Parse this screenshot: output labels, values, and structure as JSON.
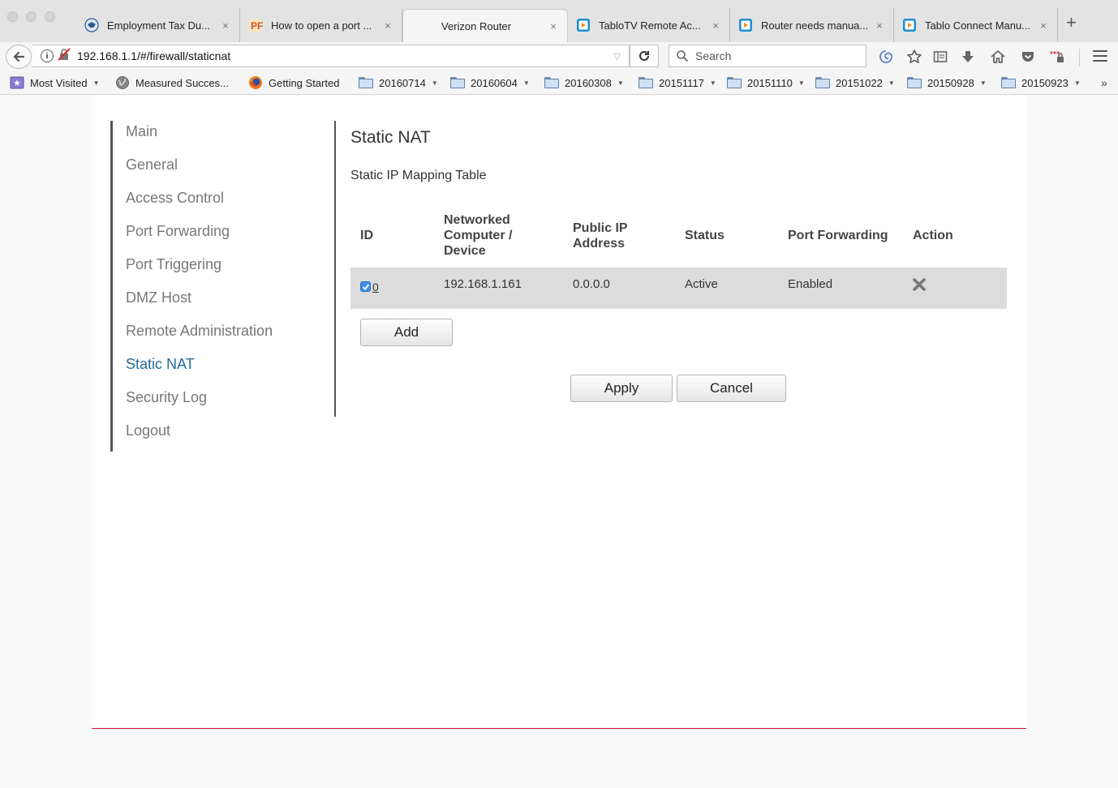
{
  "browser": {
    "tabs": [
      {
        "title": "Employment Tax Du...",
        "favicon": "irs-eagle-icon"
      },
      {
        "title": "How to open a port ...",
        "favicon": "portforward-icon"
      },
      {
        "title": "Verizon Router",
        "favicon": "none",
        "active": true
      },
      {
        "title": "TabloTV Remote Ac...",
        "favicon": "tablo-icon"
      },
      {
        "title": "Router needs manua...",
        "favicon": "tablo-icon"
      },
      {
        "title": "Tablo Connect Manu...",
        "favicon": "tablo-icon"
      }
    ],
    "new_tab_label": "+",
    "close_label": "×",
    "url": "192.168.1.1/#/firewall/staticnat",
    "search_placeholder": "Search",
    "bookmarks": [
      {
        "label": "Most Visited",
        "dropdown": true
      },
      {
        "label": "Measured Succes...",
        "dropdown": false
      },
      {
        "label": "Getting Started",
        "dropdown": false
      },
      {
        "label": "20160714",
        "dropdown": true
      },
      {
        "label": "20160604",
        "dropdown": true
      },
      {
        "label": "20160308",
        "dropdown": true
      },
      {
        "label": "20151117",
        "dropdown": true
      },
      {
        "label": "20151110",
        "dropdown": true
      },
      {
        "label": "20151022",
        "dropdown": true
      },
      {
        "label": "20150928",
        "dropdown": true
      },
      {
        "label": "20150923",
        "dropdown": true
      }
    ],
    "bookmarks_overflow": "»"
  },
  "sidebar": {
    "items": [
      {
        "label": "Main"
      },
      {
        "label": "General"
      },
      {
        "label": "Access Control"
      },
      {
        "label": "Port Forwarding"
      },
      {
        "label": "Port Triggering"
      },
      {
        "label": "DMZ Host"
      },
      {
        "label": "Remote Administration"
      },
      {
        "label": "Static NAT",
        "active": true
      },
      {
        "label": "Security Log"
      },
      {
        "label": "Logout"
      }
    ]
  },
  "main": {
    "title": "Static NAT",
    "table_title": "Static IP Mapping Table",
    "columns": [
      "ID",
      "Networked\nComputer /\nDevice",
      "Public IP\nAddress",
      "Status",
      "Port Forwarding",
      "Action"
    ],
    "rows": [
      {
        "id": "0",
        "checked": true,
        "device": "192.168.1.161",
        "public_ip": "0.0.0.0",
        "status": "Active",
        "port_forwarding": "Enabled"
      }
    ],
    "add_label": "Add",
    "apply_label": "Apply",
    "cancel_label": "Cancel"
  },
  "colors": {
    "accent": "#1f6b99",
    "brand_line": "#c8102e",
    "row_bg": "#dcdcdc"
  }
}
